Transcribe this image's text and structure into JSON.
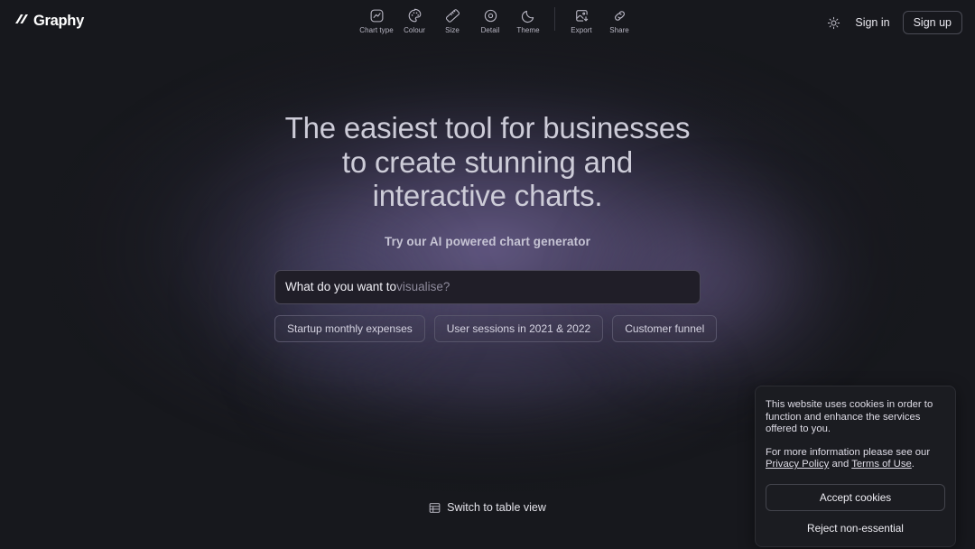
{
  "brand": {
    "name": "Graphy",
    "logo_icon": "slash-mark-icon"
  },
  "toolbar": {
    "items": [
      {
        "label": "Chart type",
        "icon": "chart-type-icon"
      },
      {
        "label": "Colour",
        "icon": "palette-icon"
      },
      {
        "label": "Size",
        "icon": "ruler-icon"
      },
      {
        "label": "Detail",
        "icon": "detail-eye-icon"
      },
      {
        "label": "Theme",
        "icon": "moon-icon"
      },
      {
        "label": "Export",
        "icon": "image-export-icon"
      },
      {
        "label": "Share",
        "icon": "link-share-icon"
      }
    ]
  },
  "account": {
    "theme_toggle_icon": "sun-icon",
    "sign_in_label": "Sign in",
    "sign_up_label": "Sign up"
  },
  "hero": {
    "headline_lines": [
      "The easiest tool for businesses",
      "to create stunning and",
      "interactive charts."
    ],
    "subheadline": "Try our AI powered chart generator",
    "search": {
      "value": "",
      "placeholder": "What do you want to visualise?",
      "placeholder_strong": "What do you want to ",
      "placeholder_dim": "visualise?"
    },
    "suggestions": [
      "Startup monthly expenses",
      "User sessions in 2021 & 2022",
      "Customer funnel"
    ]
  },
  "table_view": {
    "icon": "table-grid-icon",
    "label": "Switch to table view"
  },
  "cookie_banner": {
    "paragraph_1": "This website uses cookies in order to function and enhance the services offered to you.",
    "paragraph_2_prefix": "For more information please see our ",
    "privacy_link": "Privacy Policy",
    "paragraph_2_middle": " and ",
    "terms_link": "Terms of Use",
    "paragraph_2_suffix": ".",
    "accept_label": "Accept cookies",
    "reject_label": "Reject non-essential"
  },
  "colors": {
    "background": "#17181d",
    "glow_purple": "#685d8a",
    "panel": "#1b1c21",
    "input_bg": "#201e28",
    "text_primary": "#e8e8ee",
    "border": "#4a4b55"
  }
}
